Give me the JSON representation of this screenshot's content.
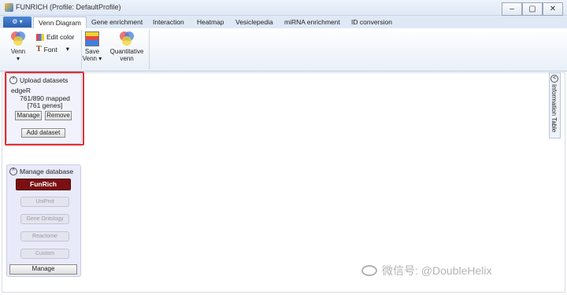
{
  "window": {
    "title": "FUNRICH (Profile: DefaultProfile)",
    "minimize": "‒",
    "maximize": "▢",
    "close": "✕"
  },
  "app_menu": "⚙ ▾",
  "tabs": [
    "Venn Diagram",
    "Gene enrichment",
    "Interaction",
    "Heatmap",
    "Vesiclepedia",
    "miRNA enrichment",
    "ID conversion"
  ],
  "ribbon": {
    "venn_label": "Venn",
    "venn_arrow": "▾",
    "edit_color": "Edit color",
    "font": "Font",
    "font_arrow": "▾",
    "save_label": "Save",
    "save_sub": "Venn ▾",
    "quant_label": "Quantitative",
    "quant_sub": "venn"
  },
  "upload": {
    "title": "Upload datasets",
    "toggle": "^",
    "dataset_name": "edgeR",
    "mapped": "761/890 mapped",
    "genes": "[761 genes]",
    "manage": "Manage",
    "remove": "Remove",
    "add": "Add dataset"
  },
  "database": {
    "title": "Manage database",
    "toggle": "^",
    "funrich": "FunRich",
    "items": [
      "UniProt",
      "Gene Ontology",
      "Reactome",
      "Custom"
    ],
    "manage": "Manage"
  },
  "info_panel": {
    "toggle": "<",
    "label": "Information Table"
  },
  "watermark": "微信号: @DoubleHelix",
  "colors": {
    "highlight": "#e03030",
    "funrich": "#7b0f12",
    "tab_bar": "#dfe8f5"
  }
}
